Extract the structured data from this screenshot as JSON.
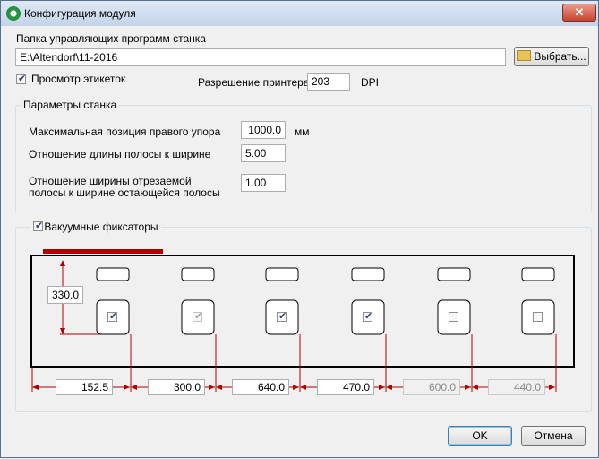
{
  "window": {
    "title": "Конфигурация модуля",
    "close_glyph": "✕"
  },
  "folder": {
    "label": "Папка управляющих программ станка",
    "value": "E:\\Altendorf\\11-2016",
    "browse_label": "Выбрать..."
  },
  "preview": {
    "label": "Просмотр этикеток",
    "checked": true
  },
  "printer": {
    "label": "Разрешение принтера",
    "value": "203",
    "unit": "DPI"
  },
  "machine": {
    "group_label": "Параметры станка",
    "max_pos_label": "Максимальная позиция правого упора",
    "max_pos_value": "1000.0",
    "max_pos_unit": "мм",
    "ratio_label": "Отношение длины полосы к ширине",
    "ratio_value": "5.00",
    "width_ratio_label_1": "Отношение ширины отрезаемой",
    "width_ratio_label_2": "полосы к ширине остающейся полосы",
    "width_ratio_value": "1.00"
  },
  "vacuum": {
    "label": "Вакуумные фиксаторы",
    "enabled": true,
    "offset_value": "330.0",
    "clamps": [
      {
        "checked": true,
        "enabled": true
      },
      {
        "checked": true,
        "enabled": false
      },
      {
        "checked": true,
        "enabled": true
      },
      {
        "checked": true,
        "enabled": true
      },
      {
        "checked": false,
        "enabled": true
      },
      {
        "checked": false,
        "enabled": true
      }
    ],
    "distances": [
      "152.5",
      "300.0",
      "640.0",
      "470.0",
      "600.0",
      "440.0"
    ]
  },
  "buttons": {
    "ok": "OK",
    "cancel": "Отмена"
  },
  "colors": {
    "accent": "#b00000",
    "title_bar": "#c3d4ea"
  }
}
